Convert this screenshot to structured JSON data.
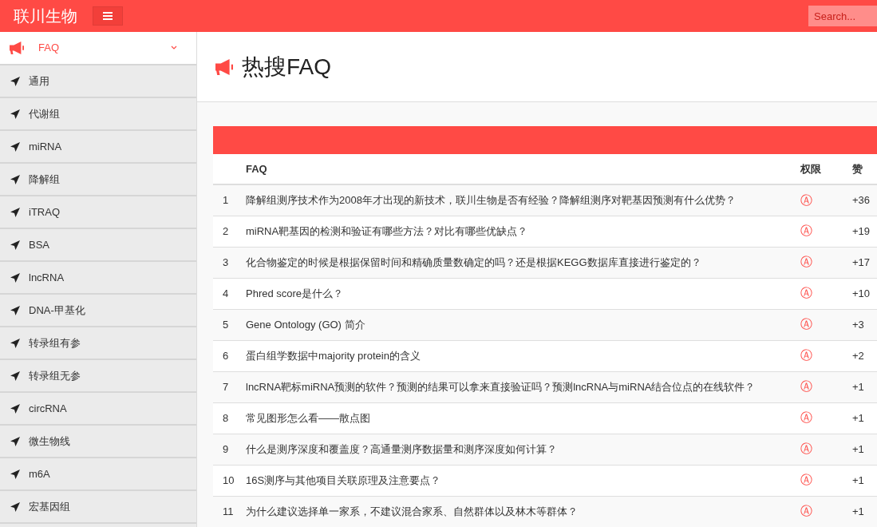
{
  "navbar": {
    "brand": "联川生物",
    "search": {
      "placeholder": "Search..."
    }
  },
  "sidebar": {
    "group": {
      "label": "FAQ",
      "expanded": true,
      "children": [
        {
          "label": "通用"
        },
        {
          "label": "代谢组"
        },
        {
          "label": "miRNA"
        },
        {
          "label": "降解组"
        },
        {
          "label": "iTRAQ"
        },
        {
          "label": "BSA"
        },
        {
          "label": "lncRNA"
        },
        {
          "label": "DNA-甲基化"
        },
        {
          "label": "转录组有参"
        },
        {
          "label": "转录组无参"
        },
        {
          "label": "circRNA"
        },
        {
          "label": "微生物线"
        },
        {
          "label": "m6A"
        },
        {
          "label": "宏基因组"
        }
      ]
    }
  },
  "page": {
    "title": "热搜FAQ"
  },
  "table": {
    "columns": [
      "FAQ",
      "权限",
      "赞"
    ],
    "rows": [
      {
        "index": "1",
        "faq": "降解组测序技术作为2008年才出现的新技术，联川生物是否有经验？降解组测序对靶基因预测有什么优势？",
        "permission": "Ⓐ",
        "likes": "+36"
      },
      {
        "index": "2",
        "faq": "miRNA靶基因的检测和验证有哪些方法？对比有哪些优缺点？",
        "permission": "Ⓐ",
        "likes": "+19"
      },
      {
        "index": "3",
        "faq": "化合物鉴定的时候是根据保留时间和精确质量数确定的吗？还是根据KEGG数据库直接进行鉴定的？",
        "permission": "Ⓐ",
        "likes": "+17"
      },
      {
        "index": "4",
        "faq": "Phred score是什么？",
        "permission": "Ⓐ",
        "likes": "+10"
      },
      {
        "index": "5",
        "faq": "Gene Ontology (GO) 简介",
        "permission": "Ⓐ",
        "likes": "+3"
      },
      {
        "index": "6",
        "faq": "蛋白组学数据中majority protein的含义",
        "permission": "Ⓐ",
        "likes": "+2"
      },
      {
        "index": "7",
        "faq": "lncRNA靶标miRNA预测的软件？预测的结果可以拿来直接验证吗？预测lncRNA与miRNA结合位点的在线软件？",
        "permission": "Ⓐ",
        "likes": "+1"
      },
      {
        "index": "8",
        "faq": "常见图形怎么看——散点图",
        "permission": "Ⓐ",
        "likes": "+1"
      },
      {
        "index": "9",
        "faq": "什么是测序深度和覆盖度？高通量测序数据量和测序深度如何计算？",
        "permission": "Ⓐ",
        "likes": "+1"
      },
      {
        "index": "10",
        "faq": "16S测序与其他项目关联原理及注意要点？",
        "permission": "Ⓐ",
        "likes": "+1"
      },
      {
        "index": "11",
        "faq": "为什么建议选择单一家系，不建议混合家系、自然群体以及林木等群体？",
        "permission": "Ⓐ",
        "likes": "+1"
      }
    ]
  }
}
